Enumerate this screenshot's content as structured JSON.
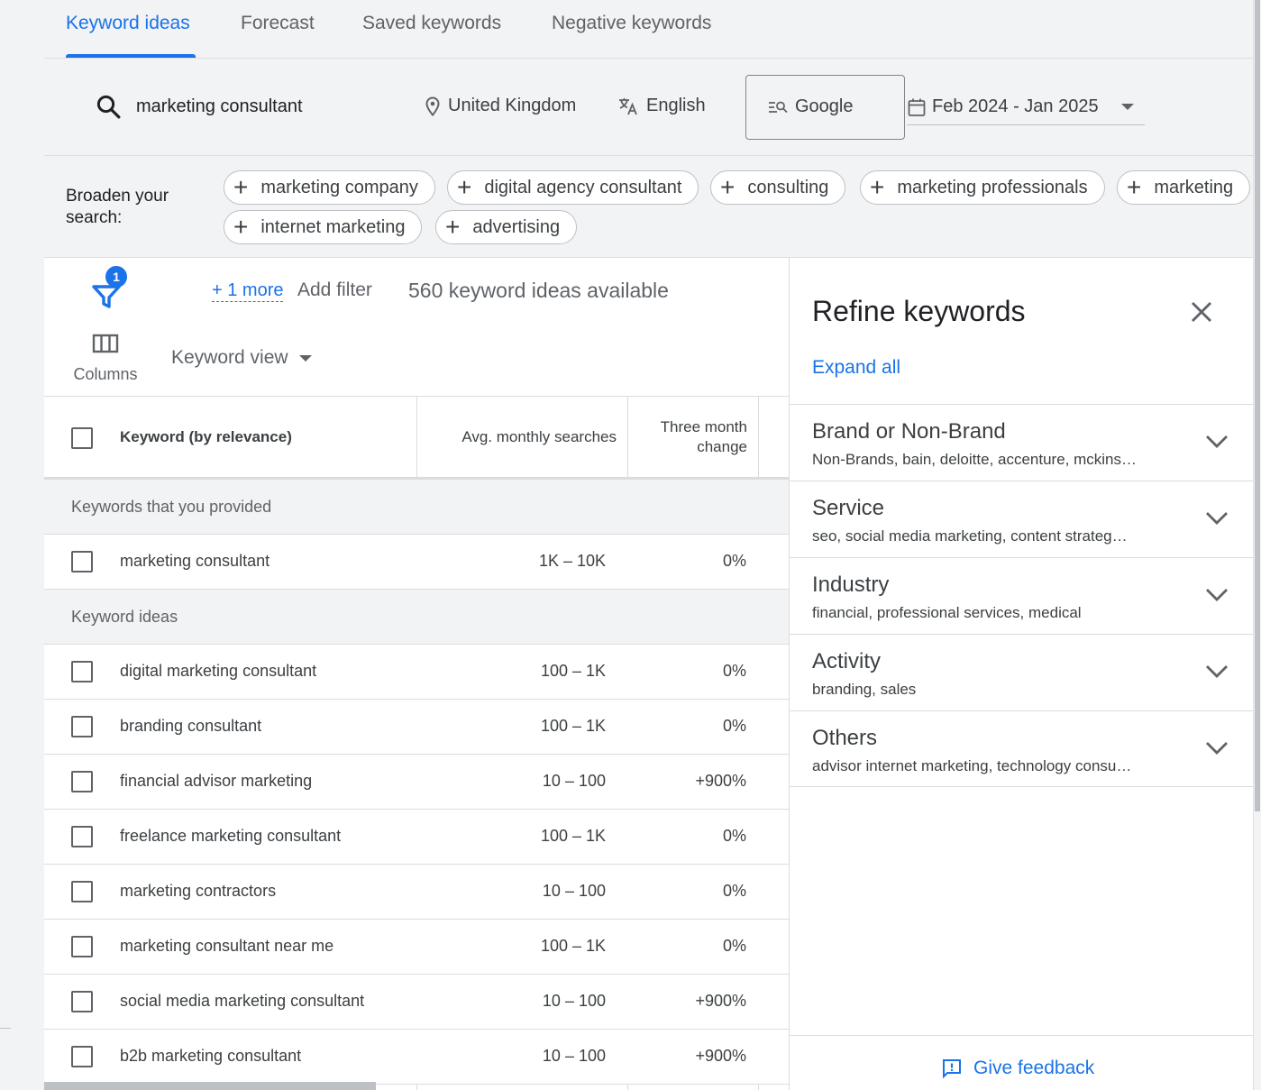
{
  "tabs": [
    "Keyword ideas",
    "Forecast",
    "Saved keywords",
    "Negative keywords"
  ],
  "search": {
    "query": "marketing consultant"
  },
  "filters": {
    "location": "United Kingdom",
    "language": "English",
    "network": "Google",
    "date_range": "Feb 2024 - Jan 2025"
  },
  "broaden": {
    "label": "Broaden your search:",
    "chips": [
      "marketing company",
      "digital agency consultant",
      "consulting",
      "marketing professionals",
      "marketing",
      "internet marketing",
      "advertising"
    ]
  },
  "toolbar": {
    "filter_badge": "1",
    "more_link": "+ 1 more",
    "add_filter": "Add filter",
    "ideas_count": "560 keyword ideas available",
    "columns_label": "Columns",
    "view_label": "Keyword view"
  },
  "table": {
    "headers": [
      "Keyword (by relevance)",
      "Avg. monthly searches",
      "Three month change"
    ],
    "provided_label": "Keywords that you provided",
    "provided_rows": [
      {
        "keyword": "marketing consultant",
        "searches": "1K – 10K",
        "change": "0%"
      }
    ],
    "ideas_label": "Keyword ideas",
    "idea_rows": [
      {
        "keyword": "digital marketing consultant",
        "searches": "100 – 1K",
        "change": "0%"
      },
      {
        "keyword": "branding consultant",
        "searches": "100 – 1K",
        "change": "0%"
      },
      {
        "keyword": "financial advisor marketing",
        "searches": "10 – 100",
        "change": "+900%"
      },
      {
        "keyword": "freelance marketing consultant",
        "searches": "100 – 1K",
        "change": "0%"
      },
      {
        "keyword": "marketing contractors",
        "searches": "10 – 100",
        "change": "0%"
      },
      {
        "keyword": "marketing consultant near me",
        "searches": "100 – 1K",
        "change": "0%"
      },
      {
        "keyword": "social media marketing consultant",
        "searches": "10 – 100",
        "change": "+900%"
      },
      {
        "keyword": "b2b marketing consultant",
        "searches": "10 – 100",
        "change": "+900%"
      }
    ]
  },
  "refine": {
    "title": "Refine keywords",
    "expand_all": "Expand all",
    "categories": [
      {
        "name": "Brand or Non-Brand",
        "summary": "Non-Brands, bain, deloitte, accenture, mckins…"
      },
      {
        "name": "Service",
        "summary": "seo, social media marketing, content strateg…"
      },
      {
        "name": "Industry",
        "summary": "financial, professional services, medical"
      },
      {
        "name": "Activity",
        "summary": "branding, sales"
      },
      {
        "name": "Others",
        "summary": "advisor internet marketing, technology consu…"
      }
    ],
    "feedback": "Give feedback"
  },
  "colors": {
    "accent": "#1a73e8",
    "text": "#3c4043",
    "muted": "#5f6368",
    "divider": "#dadce0"
  }
}
